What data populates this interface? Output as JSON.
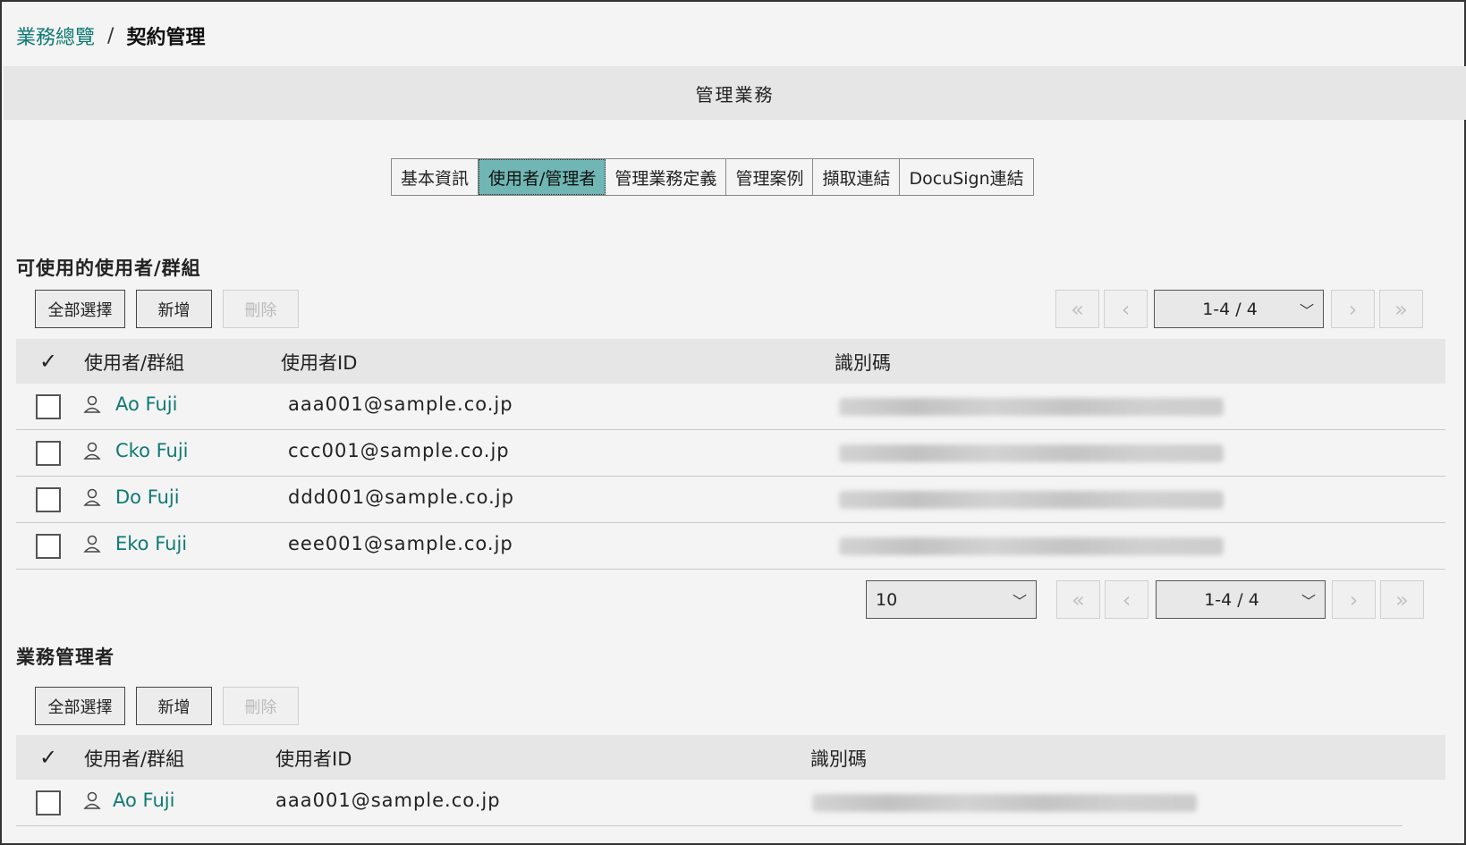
{
  "breadcrumb": {
    "parent": "業務總覽",
    "separator": "/",
    "current": "契約管理"
  },
  "section_title": "管理業務",
  "tabs": [
    {
      "label": "基本資訊"
    },
    {
      "label": "使用者/管理者"
    },
    {
      "label": "管理業務定義"
    },
    {
      "label": "管理案例"
    },
    {
      "label": "擷取連結"
    },
    {
      "label": "DocuSign連結"
    }
  ],
  "users_section": {
    "title": "可使用的使用者/群組",
    "buttons": {
      "select_all": "全部選擇",
      "add": "新增",
      "delete": "刪除"
    },
    "pager_top": {
      "range": "1-4 / 4"
    },
    "columns": {
      "check": "✓",
      "user": "使用者/群組",
      "user_id": "使用者ID",
      "identifier": "識別碼"
    },
    "rows": [
      {
        "name": "Ao Fuji",
        "user_id": "aaa001@sample.co.jp"
      },
      {
        "name": "Cko Fuji",
        "user_id": "ccc001@sample.co.jp"
      },
      {
        "name": "Do Fuji",
        "user_id": "ddd001@sample.co.jp"
      },
      {
        "name": "Eko Fuji",
        "user_id": "eee001@sample.co.jp"
      }
    ],
    "page_size": "10",
    "pager_bottom": {
      "range": "1-4 / 4"
    }
  },
  "admins_section": {
    "title": "業務管理者",
    "buttons": {
      "select_all": "全部選擇",
      "add": "新增",
      "delete": "刪除"
    },
    "columns": {
      "check": "✓",
      "user": "使用者/群組",
      "user_id": "使用者ID",
      "identifier": "識別碼"
    },
    "rows": [
      {
        "name": "Ao Fuji",
        "user_id": "aaa001@sample.co.jp"
      }
    ]
  },
  "colors": {
    "accent": "#6fb6b4",
    "link": "#0f7a73",
    "header_bg": "#e6e6e6"
  },
  "icons": {
    "first": "double-chevron-left-icon",
    "prev": "chevron-left-icon",
    "next": "chevron-right-icon",
    "last": "double-chevron-right-icon",
    "user": "user-icon",
    "dropdown": "chevron-down-icon"
  }
}
